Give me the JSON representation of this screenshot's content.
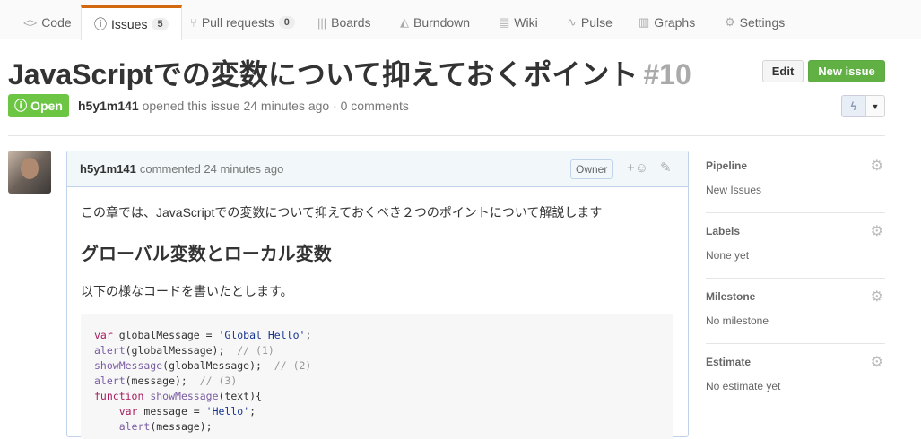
{
  "nav": {
    "tabs": [
      {
        "label": "Code",
        "icon": "code-icon",
        "glyph": "<>"
      },
      {
        "label": "Issues",
        "icon": "issue-icon",
        "glyph": "ⓘ",
        "count": "5"
      },
      {
        "label": "Pull requests",
        "icon": "pull-request-icon",
        "glyph": "⑂",
        "count": "0"
      },
      {
        "label": "Boards",
        "icon": "boards-icon",
        "glyph": "|||"
      },
      {
        "label": "Burndown",
        "icon": "burndown-icon",
        "glyph": "◭"
      },
      {
        "label": "Wiki",
        "icon": "wiki-icon",
        "glyph": "▤"
      },
      {
        "label": "Pulse",
        "icon": "pulse-icon",
        "glyph": "∿"
      },
      {
        "label": "Graphs",
        "icon": "graph-icon",
        "glyph": "▥"
      },
      {
        "label": "Settings",
        "icon": "gear-icon",
        "glyph": "⚙"
      }
    ]
  },
  "issue": {
    "title": "JavaScriptでの変数について抑えておくポイント",
    "number": "#10",
    "state": "Open",
    "author": "h5y1m141",
    "meta": "opened this issue 24 minutes ago · 0 comments"
  },
  "buttons": {
    "edit": "Edit",
    "new_issue": "New issue"
  },
  "comment": {
    "author": "h5y1m141",
    "time": "commented 24 minutes ago",
    "badge": "Owner",
    "p1": "この章では、JavaScriptでの変数について抑えておくべき２つのポイントについて解説します",
    "h2": "グローバル変数とローカル変数",
    "p2": "以下の様なコードを書いたとします。"
  },
  "sidebar": [
    {
      "heading": "Pipeline",
      "value": "New Issues"
    },
    {
      "heading": "Labels",
      "value": "None yet"
    },
    {
      "heading": "Milestone",
      "value": "No milestone"
    },
    {
      "heading": "Estimate",
      "value": "No estimate yet"
    }
  ],
  "colors": {
    "accent": "#d26911",
    "open": "#6cc644",
    "new_issue": "#60b044"
  }
}
